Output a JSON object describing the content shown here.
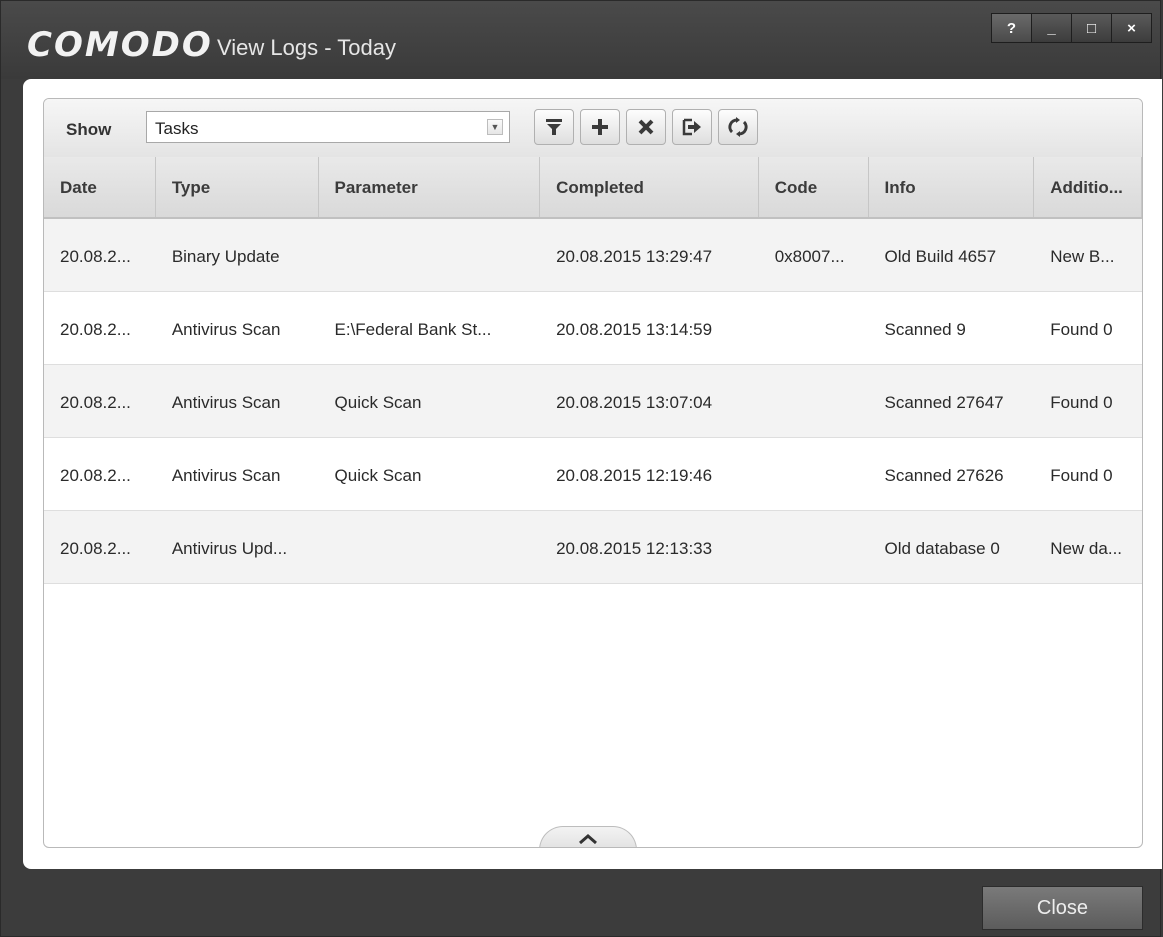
{
  "window": {
    "brand": "COMODO",
    "title": "View Logs - Today",
    "controls": {
      "help": "?",
      "minimize": "_",
      "maximize": "□",
      "close": "×"
    }
  },
  "toolbar": {
    "show_label": "Show",
    "show_value": "Tasks",
    "buttons": [
      "filter-icon",
      "add-icon",
      "delete-icon",
      "export-icon",
      "refresh-icon"
    ]
  },
  "table": {
    "columns": [
      "Date",
      "Type",
      "Parameter",
      "Completed",
      "Code",
      "Info",
      "Additio..."
    ],
    "rows": [
      [
        "20.08.2...",
        "Binary Update",
        "",
        "20.08.2015 13:29:47",
        "0x8007...",
        "Old Build 4657",
        "New B..."
      ],
      [
        "20.08.2...",
        "Antivirus Scan",
        "E:\\Federal Bank St...",
        "20.08.2015 13:14:59",
        "",
        "Scanned 9",
        "Found 0"
      ],
      [
        "20.08.2...",
        "Antivirus Scan",
        "Quick Scan",
        "20.08.2015 13:07:04",
        "",
        "Scanned 27647",
        "Found 0"
      ],
      [
        "20.08.2...",
        "Antivirus Scan",
        "Quick Scan",
        "20.08.2015 12:19:46",
        "",
        "Scanned 27626",
        "Found 0"
      ],
      [
        "20.08.2...",
        "Antivirus Upd...",
        "",
        "20.08.2015 12:13:33",
        "",
        "Old database 0",
        "New da..."
      ]
    ]
  },
  "footer": {
    "close_label": "Close"
  }
}
